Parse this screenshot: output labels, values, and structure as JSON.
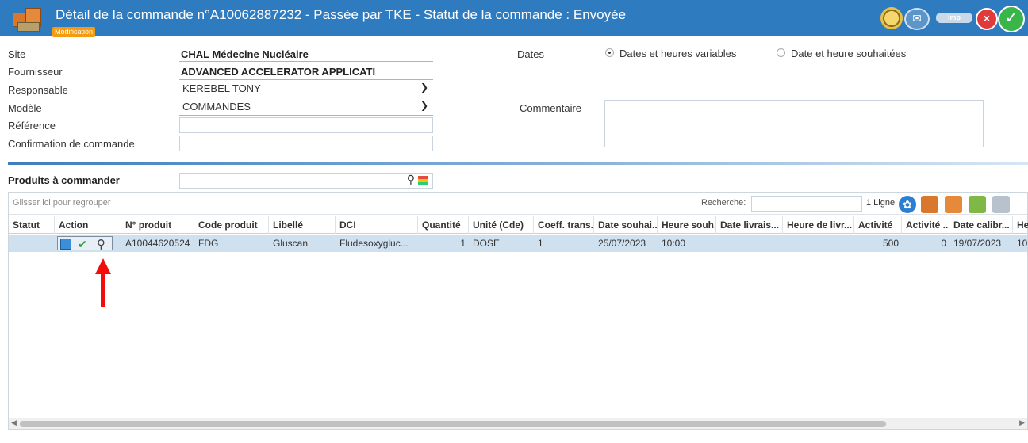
{
  "header": {
    "title": "Détail de la commande n°A10062887232 - Passée par TKE - Statut de la commande : Envoyée",
    "badge": "Modification",
    "imp_label": "Imp"
  },
  "form": {
    "site_label": "Site",
    "site_value": "CHAL Médecine Nucléaire",
    "supplier_label": "Fournisseur",
    "supplier_value": "ADVANCED ACCELERATOR APPLICATI",
    "manager_label": "Responsable",
    "manager_value": "KEREBEL TONY",
    "model_label": "Modèle",
    "model_value": "COMMANDES",
    "reference_label": "Référence",
    "reference_value": "",
    "confirmation_label": "Confirmation de commande",
    "confirmation_value": "",
    "dates_label": "Dates",
    "dates_option1": "Dates et heures variables",
    "dates_option2": "Date et heure souhaitées",
    "comment_label": "Commentaire"
  },
  "products": {
    "title": "Produits à commander",
    "group_hint": "Glisser ici pour regrouper",
    "search_label": "Recherche:",
    "row_count": "1 Ligne",
    "columns": [
      "Statut",
      "Action",
      "N° produit",
      "Code produit",
      "Libellé",
      "DCI",
      "Quantité",
      "Unité (Cde)",
      "Coeff. trans...",
      "Date souhai...",
      "Heure souh...",
      "Date livrais...",
      "Heure de livr...",
      "Activité",
      "Activité ...",
      "Date calibr...",
      "He"
    ],
    "rows": [
      {
        "statut": "",
        "numero": "A10044620524",
        "code": "FDG",
        "libelle": "Gluscan",
        "dci": "Fludesoxygluc...",
        "quantite": "1",
        "unite": "DOSE",
        "coeff": "1",
        "date_souhaitee": "25/07/2023",
        "heure_souhaitee": "10:00",
        "activite": "500",
        "activite2": "0",
        "date_calibr": "19/07/2023",
        "he": "10"
      }
    ]
  }
}
